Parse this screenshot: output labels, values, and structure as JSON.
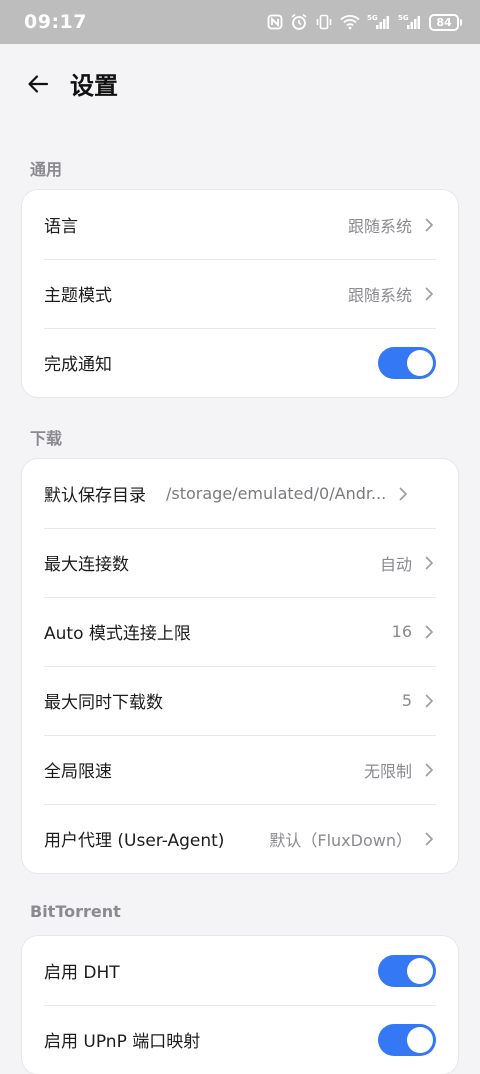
{
  "status_bar": {
    "time": "09:17",
    "signal_1_label": "5G",
    "signal_2_label": "5G",
    "battery": "84"
  },
  "header": {
    "title": "设置"
  },
  "sections": {
    "general": {
      "label": "通用",
      "language": {
        "label": "语言",
        "value": "跟随系统"
      },
      "theme": {
        "label": "主题模式",
        "value": "跟随系统"
      },
      "notify": {
        "label": "完成通知",
        "enabled": true
      }
    },
    "download": {
      "label": "下载",
      "save_dir": {
        "label": "默认保存目录",
        "value": "/storage/emulated/0/Andr..."
      },
      "max_conn": {
        "label": "最大连接数",
        "value": "自动"
      },
      "auto_conn_limit": {
        "label": "Auto 模式连接上限",
        "value": "16"
      },
      "max_concurrent": {
        "label": "最大同时下载数",
        "value": "5"
      },
      "speed_limit": {
        "label": "全局限速",
        "value": "无限制"
      },
      "user_agent": {
        "label": "用户代理 (User-Agent)",
        "value": "默认（FluxDown）"
      }
    },
    "bittorrent": {
      "label": "BitTorrent",
      "dht": {
        "label": "启用 DHT",
        "enabled": true
      },
      "upnp": {
        "label": "启用 UPnP 端口映射",
        "enabled": true
      }
    }
  },
  "colors": {
    "accent": "#3478f6",
    "status_bar_bg": "#bdbdbd",
    "page_bg": "#f4f4f6"
  }
}
